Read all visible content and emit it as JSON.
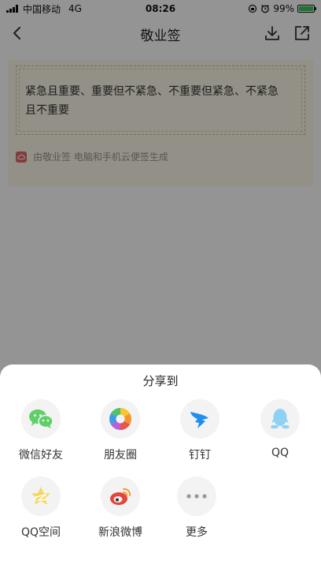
{
  "status_bar": {
    "carrier": "中国移动",
    "network": "4G",
    "time": "08:26",
    "battery_percent": "99%",
    "battery_level": 0.99,
    "battery_color": "#34c759"
  },
  "nav": {
    "title": "敬业签",
    "back_icon": "chevron-left-icon",
    "download_icon": "download-icon",
    "share_icon": "external-share-icon"
  },
  "note": {
    "text": "紧急且重要、重要但不紧急、不重要但紧急、不紧急且不重要",
    "footer": "由敬业签 电脑和手机云便签生成",
    "footer_icon": "cloud-note-icon",
    "card_color": "#fdf8e8"
  },
  "share_sheet": {
    "title": "分享到",
    "items": [
      {
        "label": "微信好友",
        "icon": "wechat-icon"
      },
      {
        "label": "朋友圈",
        "icon": "moments-icon"
      },
      {
        "label": "钉钉",
        "icon": "dingtalk-icon"
      },
      {
        "label": "QQ",
        "icon": "qq-icon"
      },
      {
        "label": "QQ空间",
        "icon": "qzone-icon"
      },
      {
        "label": "新浪微博",
        "icon": "weibo-icon"
      },
      {
        "label": "更多",
        "icon": "more-icon"
      }
    ]
  }
}
